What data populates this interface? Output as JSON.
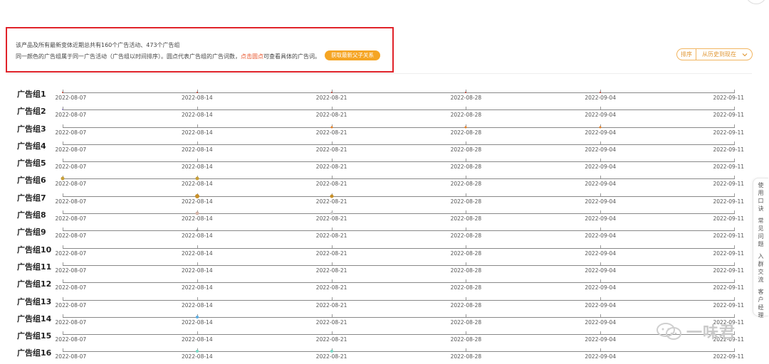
{
  "notice": {
    "line1": "该产品及所有最新变体近期总共有160个广告活动、473个广告组",
    "line2_pre": "同一颜色的广告组属于同一广告活动（广告组以时间排序）。圆点代表广告组的广告词数，",
    "line2_highlight": "点击圆点",
    "line2_post": "可查看具体的广告词。",
    "fetch_button": "获取最新父子关系"
  },
  "sort": {
    "label": "排序",
    "value": "从历史到现在"
  },
  "timeline": {
    "dates": [
      "2022-08-07",
      "2022-08-14",
      "2022-08-21",
      "2022-08-28",
      "2022-09-04",
      "2022-09-11"
    ],
    "groups": [
      {
        "label": "广告组1",
        "dots": [
          {
            "d": 0,
            "size": 2,
            "color": "#c0392b"
          },
          {
            "d": 1,
            "size": 2,
            "color": "#c0392b"
          },
          {
            "d": 2,
            "size": 2,
            "color": "#c0392b"
          },
          {
            "d": 3,
            "size": 2,
            "color": "#c0392b"
          },
          {
            "d": 4,
            "size": 2,
            "color": "#c0392b"
          }
        ]
      },
      {
        "label": "广告组2",
        "dots": [
          {
            "d": 0,
            "size": 2,
            "color": "#8e7cc3"
          }
        ]
      },
      {
        "label": "广告组3",
        "dots": [
          {
            "d": 2,
            "size": 3,
            "color": "#e67e22"
          },
          {
            "d": 3,
            "size": 3,
            "color": "#e67e22"
          },
          {
            "d": 4,
            "size": 3,
            "color": "#e67e22"
          }
        ]
      },
      {
        "label": "广告组4",
        "dots": []
      },
      {
        "label": "广告组5",
        "dots": []
      },
      {
        "label": "广告组6",
        "dots": [
          {
            "d": 0,
            "size": 5,
            "color": "#c8a03a"
          },
          {
            "d": 1,
            "size": 5,
            "color": "#c8a03a"
          }
        ]
      },
      {
        "label": "广告组7",
        "dots": [
          {
            "d": 1,
            "size": 6,
            "color": "#c8902a"
          },
          {
            "d": 2,
            "size": 5,
            "color": "#c8902a"
          }
        ]
      },
      {
        "label": "广告组8",
        "dots": [
          {
            "d": 1,
            "size": 5,
            "color": "#d2b4a8"
          },
          {
            "d": 2,
            "size": 4,
            "color": "#c8c8c8"
          }
        ]
      },
      {
        "label": "广告组9",
        "dots": [
          {
            "d": 1,
            "size": 3,
            "color": "#888888"
          }
        ]
      },
      {
        "label": "广告组10",
        "dots": []
      },
      {
        "label": "广告组11",
        "dots": []
      },
      {
        "label": "广告组12",
        "dots": []
      },
      {
        "label": "广告组13",
        "dots": []
      },
      {
        "label": "广告组14",
        "dots": [
          {
            "d": 1,
            "size": 4,
            "color": "#5dade2"
          }
        ]
      },
      {
        "label": "广告组15",
        "dots": []
      },
      {
        "label": "广告组16",
        "dots": [
          {
            "d": 1,
            "size": 4,
            "color": "#76d7c4"
          },
          {
            "d": 2,
            "size": 4,
            "color": "#76d7c4"
          }
        ]
      }
    ]
  },
  "sidebar": {
    "items": [
      "使用口诀",
      "常见问题",
      "入群交流",
      "客户经理"
    ]
  },
  "watermark": "一味君"
}
